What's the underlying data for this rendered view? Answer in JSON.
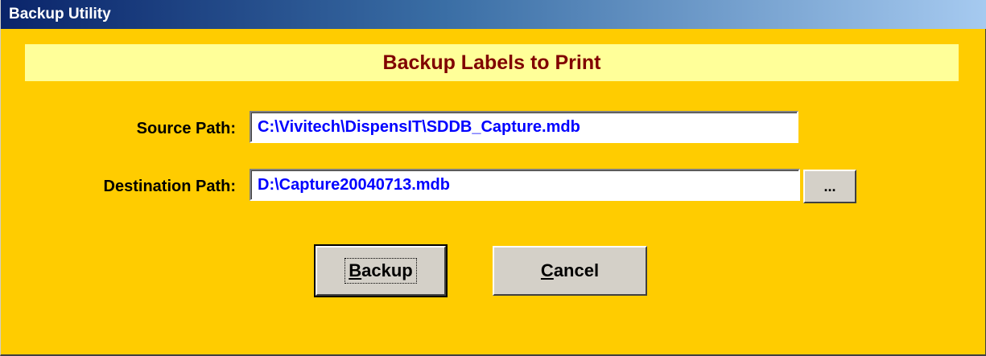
{
  "window": {
    "title": "Backup Utility"
  },
  "banner": {
    "text": "Backup Labels to Print"
  },
  "source": {
    "label": "Source Path:",
    "value": "C:\\Vivitech\\DispensIT\\SDDB_Capture.mdb"
  },
  "destination": {
    "label": "Destination Path:",
    "value": "D:\\Capture20040713.mdb",
    "browse_label": "..."
  },
  "buttons": {
    "backup": {
      "accel": "B",
      "rest": "ackup"
    },
    "cancel": {
      "accel": "C",
      "rest": "ancel"
    }
  },
  "colors": {
    "form_background": "#ffcc00",
    "banner_background": "#ffff99",
    "banner_text": "#800000",
    "input_text": "#0000ff",
    "titlebar_start": "#0a246a",
    "titlebar_end": "#a6caf0"
  }
}
